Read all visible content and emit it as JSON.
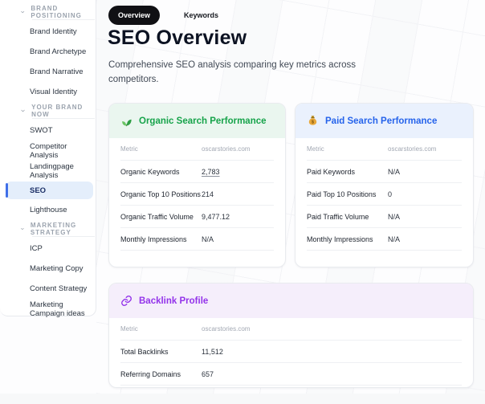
{
  "sidebar": {
    "sections": [
      {
        "label": "BRAND POSITIONING",
        "items": [
          {
            "label": "Brand Identity"
          },
          {
            "label": "Brand Archetype"
          },
          {
            "label": "Brand Narrative"
          },
          {
            "label": "Visual Identity"
          }
        ]
      },
      {
        "label": "YOUR BRAND NOW",
        "items": [
          {
            "label": "SWOT"
          },
          {
            "label": "Competitor Analysis"
          },
          {
            "label": "Landingpage Analysis"
          },
          {
            "label": "SEO",
            "active": true
          },
          {
            "label": "Lighthouse"
          }
        ]
      },
      {
        "label": "MARKETING STRATEGY",
        "items": [
          {
            "label": "ICP"
          },
          {
            "label": "Marketing Copy"
          },
          {
            "label": "Content Strategy"
          },
          {
            "label": "Marketing Campaign ideas"
          }
        ]
      }
    ]
  },
  "main": {
    "tabs": [
      {
        "label": "Overview",
        "active": true
      },
      {
        "label": "Keywords",
        "active": false
      }
    ],
    "title": "SEO Overview",
    "description": "Comprehensive SEO analysis comparing key metrics across competitors."
  },
  "cards": [
    {
      "icon": "seedling-icon",
      "title": "Organic Search Performance",
      "columns": [
        "Metric",
        "oscarstories.com"
      ],
      "rows": [
        {
          "metric": "Organic Keywords",
          "value": "2,783"
        },
        {
          "metric": "Organic Top 10 Positions",
          "value": "214"
        },
        {
          "metric": "Organic Traffic Volume",
          "value": "9,477.12"
        },
        {
          "metric": "Monthly Impressions",
          "value": "N/A"
        }
      ]
    },
    {
      "icon": "money-bag-icon",
      "title": "Paid Search Performance",
      "columns": [
        "Metric",
        "oscarstories.com"
      ],
      "rows": [
        {
          "metric": "Paid Keywords",
          "value": "N/A"
        },
        {
          "metric": "Paid Top 10 Positions",
          "value": "0"
        },
        {
          "metric": "Paid Traffic Volume",
          "value": "N/A"
        },
        {
          "metric": "Monthly Impressions",
          "value": "N/A"
        }
      ]
    },
    {
      "icon": "link-icon",
      "title": "Backlink Profile",
      "columns": [
        "Metric",
        "oscarstories.com"
      ],
      "rows": [
        {
          "metric": "Total Backlinks",
          "value": "11,512"
        },
        {
          "metric": "Referring Domains",
          "value": "657"
        }
      ]
    }
  ],
  "colors": {
    "organic_accent": "#16a34a",
    "organic_header_bg": "#eaf6ef",
    "paid_accent": "#2563eb",
    "paid_header_bg": "#eaf1fd",
    "backlink_accent": "#9333ea",
    "backlink_header_bg": "#f5eefb",
    "active_tab_bg": "#101014",
    "selected_item_bg": "#e4eefb",
    "selected_item_bar": "#3f6fe8"
  }
}
